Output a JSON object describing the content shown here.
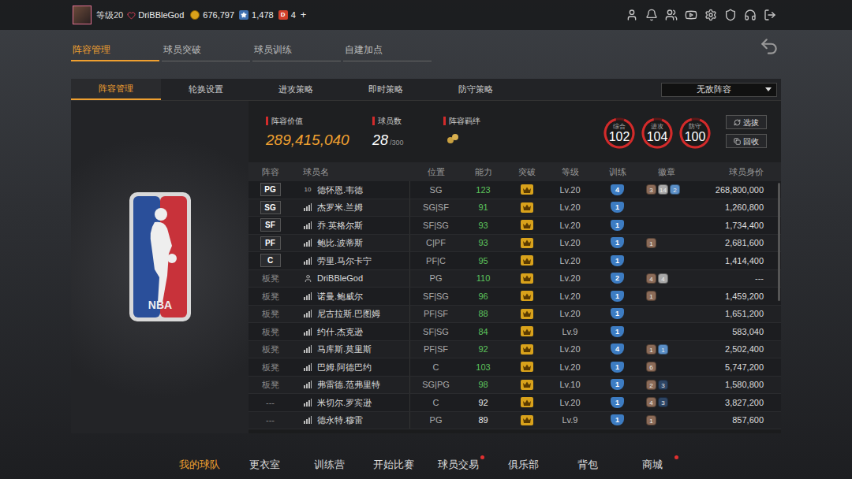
{
  "top_bar": {
    "level": "等级20",
    "username": "DriBBleGod",
    "coins": "676,797",
    "points": "1,478",
    "premium_icon": "D",
    "premium": "4",
    "add": "+"
  },
  "main_tabs": [
    {
      "label": "阵容管理",
      "selected": true
    },
    {
      "label": "球员突破",
      "selected": false
    },
    {
      "label": "球员训练",
      "selected": false
    },
    {
      "label": "自建加点",
      "selected": false
    }
  ],
  "sub_tabs": [
    {
      "label": "阵容管理",
      "selected": true
    },
    {
      "label": "轮换设置",
      "selected": false
    },
    {
      "label": "进攻策略",
      "selected": false
    },
    {
      "label": "即时策略",
      "selected": false
    },
    {
      "label": "防守策略",
      "selected": false
    }
  ],
  "lineup_select": {
    "value": "无敌阵容"
  },
  "logo": {
    "text": "NBA"
  },
  "summary": {
    "value_label": "阵容价值",
    "value": "289,415,040",
    "count_label": "球员数",
    "count": "28",
    "count_max": "/300",
    "bond_label": "阵容羁绊"
  },
  "ratings": [
    {
      "label": "综合",
      "value": "102",
      "level": 0.9
    },
    {
      "label": "进攻",
      "value": "104",
      "level": 0.9
    },
    {
      "label": "防守",
      "value": "100",
      "level": 0.9
    }
  ],
  "actions": [
    "选拔",
    "回收"
  ],
  "table": {
    "columns": [
      "阵容",
      "球员名",
      "位置",
      "能力",
      "突破",
      "等级",
      "训练",
      "徽章",
      "球员身价"
    ],
    "rows": [
      {
        "slot": "PG",
        "slot_kind": "starter",
        "icon": "number",
        "jersey": "10",
        "name": "德怀恩.韦德",
        "position": "SG",
        "ability": "123",
        "ability_color": "#5cc35c",
        "breakthrough": true,
        "grade": "Lv.20",
        "training": "4",
        "badges": [
          {
            "count": "3",
            "color": "#8b6b58"
          },
          {
            "count": "14",
            "color": "#a9a9a9"
          },
          {
            "count": "2",
            "color": "#5b8fc7"
          }
        ],
        "value": "268,800,000"
      },
      {
        "slot": "SG",
        "slot_kind": "starter",
        "icon": "bars",
        "name": "杰罗米.兰姆",
        "position": "SG|SF",
        "ability": "91",
        "ability_color": "#5cc35c",
        "breakthrough": true,
        "grade": "Lv.20",
        "training": "1",
        "badges": [],
        "value": "1,260,800"
      },
      {
        "slot": "SF",
        "slot_kind": "starter",
        "icon": "bars",
        "name": "乔.英格尔斯",
        "position": "SF|SG",
        "ability": "93",
        "ability_color": "#5cc35c",
        "breakthrough": true,
        "grade": "Lv.20",
        "training": "1",
        "badges": [],
        "value": "1,734,400"
      },
      {
        "slot": "PF",
        "slot_kind": "starter",
        "icon": "bars",
        "name": "鲍比.波蒂斯",
        "position": "C|PF",
        "ability": "93",
        "ability_color": "#5cc35c",
        "breakthrough": true,
        "grade": "Lv.20",
        "training": "1",
        "badges": [
          {
            "count": "1",
            "color": "#8b6b58"
          }
        ],
        "value": "2,681,600"
      },
      {
        "slot": "C",
        "slot_kind": "starter",
        "icon": "bars",
        "name": "劳里.马尔卡宁",
        "position": "PF|C",
        "ability": "95",
        "ability_color": "#5cc35c",
        "breakthrough": true,
        "grade": "Lv.20",
        "training": "1",
        "badges": [],
        "value": "1,414,400"
      },
      {
        "slot": "板凳",
        "slot_kind": "bench",
        "icon": "person",
        "name": "DriBBleGod",
        "position": "PG",
        "ability": "110",
        "ability_color": "#5cc35c",
        "breakthrough": true,
        "grade": "Lv.20",
        "training": "2",
        "badges": [
          {
            "count": "4",
            "color": "#8b6b58"
          },
          {
            "count": "4",
            "color": "#a9a9a9"
          }
        ],
        "value": "---"
      },
      {
        "slot": "板凳",
        "slot_kind": "bench",
        "icon": "bars",
        "name": "诺曼.鲍威尔",
        "position": "SF|SG",
        "ability": "96",
        "ability_color": "#5cc35c",
        "breakthrough": true,
        "grade": "Lv.20",
        "training": "1",
        "badges": [
          {
            "count": "1",
            "color": "#8b6b58"
          }
        ],
        "value": "1,459,200"
      },
      {
        "slot": "板凳",
        "slot_kind": "bench",
        "icon": "bars",
        "name": "尼古拉斯.巴图姆",
        "position": "PF|SF",
        "ability": "88",
        "ability_color": "#5cc35c",
        "breakthrough": true,
        "grade": "Lv.20",
        "training": "1",
        "badges": [],
        "value": "1,651,200"
      },
      {
        "slot": "板凳",
        "slot_kind": "bench",
        "icon": "bars",
        "name": "约什.杰克逊",
        "position": "SF|SG",
        "ability": "84",
        "ability_color": "#5cc35c",
        "breakthrough": true,
        "grade": "Lv.9",
        "training": "1",
        "badges": [],
        "value": "583,040"
      },
      {
        "slot": "板凳",
        "slot_kind": "bench",
        "icon": "bars",
        "name": "马库斯.莫里斯",
        "position": "PF|SF",
        "ability": "92",
        "ability_color": "#5cc35c",
        "breakthrough": true,
        "grade": "Lv.20",
        "training": "4",
        "badges": [
          {
            "count": "1",
            "color": "#8b6b58"
          },
          {
            "count": "1",
            "color": "#5b8fc7"
          }
        ],
        "value": "2,502,400"
      },
      {
        "slot": "板凳",
        "slot_kind": "bench",
        "icon": "bars",
        "name": "巴姆.阿德巴约",
        "position": "C",
        "ability": "103",
        "ability_color": "#5cc35c",
        "breakthrough": true,
        "grade": "Lv.20",
        "training": "1",
        "badges": [
          {
            "count": "6",
            "color": "#8b6b58"
          }
        ],
        "value": "5,747,200"
      },
      {
        "slot": "板凳",
        "slot_kind": "bench",
        "icon": "bars",
        "name": "弗雷德.范弗里特",
        "position": "SG|PG",
        "ability": "98",
        "ability_color": "#5cc35c",
        "breakthrough": true,
        "grade": "Lv.10",
        "training": "1",
        "badges": [
          {
            "count": "2",
            "color": "#8b6b58"
          },
          {
            "count": "3",
            "color": "#2d4564"
          }
        ],
        "value": "1,580,800"
      },
      {
        "slot": "---",
        "slot_kind": "reserve",
        "icon": "bars",
        "name": "米切尔.罗宾逊",
        "position": "C",
        "ability": "92",
        "ability_color": "#e8e8e8",
        "breakthrough": true,
        "grade": "Lv.20",
        "training": "1",
        "badges": [
          {
            "count": "4",
            "color": "#8b6b58"
          },
          {
            "count": "3",
            "color": "#2d4564"
          }
        ],
        "value": "3,827,200"
      },
      {
        "slot": "---",
        "slot_kind": "reserve",
        "icon": "bars",
        "name": "德永特.穆雷",
        "position": "PG",
        "ability": "89",
        "ability_color": "#e8e8e8",
        "breakthrough": true,
        "grade": "Lv.9",
        "training": "1",
        "badges": [
          {
            "count": "1",
            "color": "#8b6b58"
          }
        ],
        "value": "857,600"
      }
    ]
  },
  "bottom_nav": [
    {
      "label": "我的球队",
      "selected": true,
      "notify": false
    },
    {
      "label": "更衣室",
      "selected": false,
      "notify": false
    },
    {
      "label": "训练营",
      "selected": false,
      "notify": false
    },
    {
      "label": "开始比赛",
      "selected": false,
      "notify": false
    },
    {
      "label": "球员交易",
      "selected": false,
      "notify": true
    },
    {
      "label": "俱乐部",
      "selected": false,
      "notify": false
    },
    {
      "label": "背包",
      "selected": false,
      "notify": false
    },
    {
      "label": "商城",
      "selected": false,
      "notify": true
    }
  ]
}
